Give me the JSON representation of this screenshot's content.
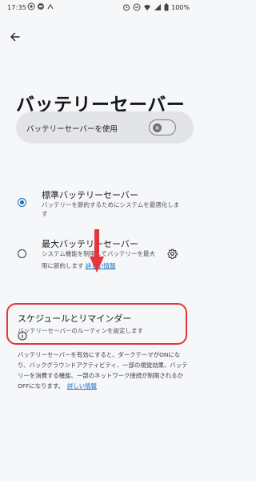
{
  "status_bar": {
    "time": "17:35",
    "battery": "100%",
    "left_icons": [
      "camera-icon",
      "message-icon",
      "signal-icon"
    ],
    "right_icons": [
      "alarm-icon",
      "dnd-icon",
      "wifi-icon",
      "signal-icon",
      "battery-icon"
    ]
  },
  "header": {
    "title": "バッテリーセーバー"
  },
  "main_toggle": {
    "label": "バッテリーセーバーを使用",
    "state": "off"
  },
  "options": [
    {
      "title": "標準バッテリーセーバー",
      "subtitle_line1": "バッテリーを節約するためにシステムを最適化しま",
      "subtitle_line2": "す",
      "selected": true
    },
    {
      "title": "最大バッテリーセーバー",
      "subtitle_line1": "システム機能を制限してバッテリーを最大",
      "subtitle_line2": "限に節約します",
      "link": "詳しい情報",
      "selected": false
    }
  ],
  "schedule": {
    "title": "スケジュールとリマインダー",
    "subtitle": "バッテリーセーバーのルーティンを設定します"
  },
  "info": {
    "text": "バッテリーセーバーを有効にすると、ダークテーマがONになり、バックグラウンドアクティビティ、一部の視覚効果、バッテリーを消費する機能、一部のネットワーク接続が制限されるかOFFになります。",
    "link": "詳しい情報"
  },
  "colors": {
    "accent": "#1a6cc0",
    "highlight": "#e5343b",
    "background": "#f6f7f8",
    "card": "#e3e4e8"
  }
}
